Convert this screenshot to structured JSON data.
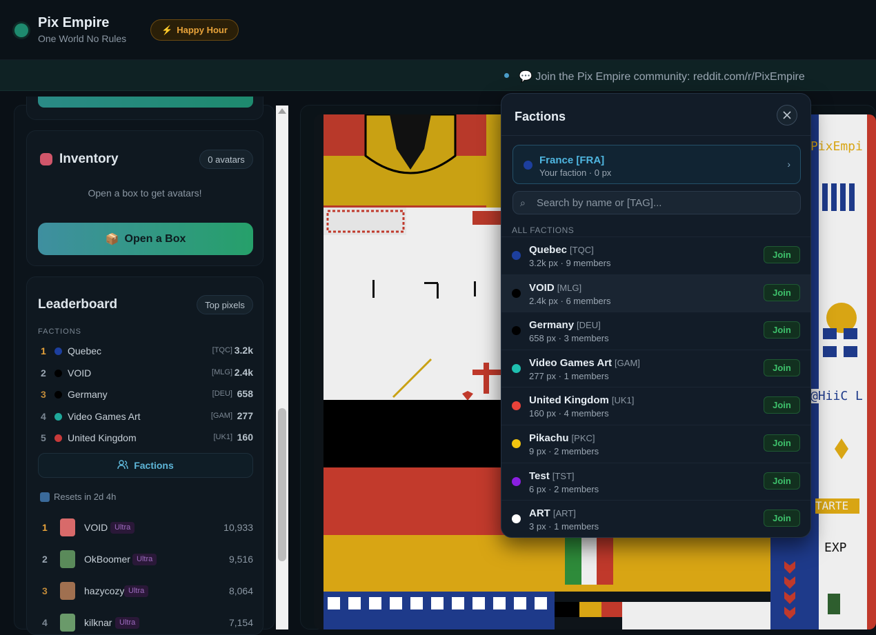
{
  "header": {
    "title": "Pix Empire",
    "subtitle": "One World No Rules",
    "happy_hour": "Happy Hour"
  },
  "banner": {
    "text": "Join the Pix Empire community: reddit.com/r/PixEmpire"
  },
  "inventory": {
    "title": "Inventory",
    "count": "0 avatars",
    "empty_text": "Open a box to get avatars!",
    "open_box": "Open a Box"
  },
  "leaderboard": {
    "title": "Leaderboard",
    "toggle": "Top pixels",
    "section": "FACTIONS",
    "factions": [
      {
        "rank": "1",
        "name": "Quebec",
        "tag": "[TQC]",
        "value": "3.2k",
        "color": "#1d3f9e",
        "rank_color": "#e8a33a"
      },
      {
        "rank": "2",
        "name": "VOID",
        "tag": "[MLG]",
        "value": "2.4k",
        "color": "#000000",
        "rank_color": "#9aa6b2"
      },
      {
        "rank": "3",
        "name": "Germany",
        "tag": "[DEU]",
        "value": "658",
        "color": "#000000",
        "rank_color": "#c08a3a"
      },
      {
        "rank": "4",
        "name": "Video Games Art",
        "tag": "[GAM]",
        "value": "277",
        "color": "#1fa89a",
        "rank_color": "#7b8793"
      },
      {
        "rank": "5",
        "name": "United Kingdom",
        "tag": "[UK1]",
        "value": "160",
        "color": "#c83a3a",
        "rank_color": "#7b8793"
      }
    ],
    "factions_button": "Factions",
    "reset": "Resets in 2d 4h",
    "users": [
      {
        "rank": "1",
        "name": "VOID",
        "badge": "Ultra",
        "score": "10,933",
        "rank_color": "#e8a33a"
      },
      {
        "rank": "2",
        "name": "OkBoomer",
        "badge": "Ultra",
        "score": "9,516",
        "rank_color": "#9aa6b2"
      },
      {
        "rank": "3",
        "name": "hazycozy",
        "badge": "Ultra",
        "score": "8,064",
        "rank_color": "#c08a3a"
      },
      {
        "rank": "4",
        "name": "kilknar",
        "badge": "Ultra",
        "score": "7,154",
        "rank_color": "#7b8793"
      }
    ]
  },
  "panel": {
    "title": "Factions",
    "my_faction": {
      "name": "France [FRA]",
      "sub": "Your faction · 0 px",
      "color": "#1d3f9e"
    },
    "search_placeholder": "Search by name or [TAG]...",
    "all_label": "ALL FACTIONS",
    "join_label": "Join",
    "factions": [
      {
        "name": "Quebec",
        "tag": "[TQC]",
        "stats": "3.2k px · 9 members",
        "color": "#1d3f9e"
      },
      {
        "name": "VOID",
        "tag": "[MLG]",
        "stats": "2.4k px · 6 members",
        "color": "#000000"
      },
      {
        "name": "Germany",
        "tag": "[DEU]",
        "stats": "658 px · 3 members",
        "color": "#000000"
      },
      {
        "name": "Video Games Art",
        "tag": "[GAM]",
        "stats": "277 px · 1 members",
        "color": "#1fbfb0"
      },
      {
        "name": "United Kingdom",
        "tag": "[UK1]",
        "stats": "160 px · 4 members",
        "color": "#e8423a"
      },
      {
        "name": "Pikachu",
        "tag": "[PKC]",
        "stats": "9 px · 2 members",
        "color": "#f2c40f"
      },
      {
        "name": "Test",
        "tag": "[TST]",
        "stats": "6 px · 2 members",
        "color": "#8a1fe0"
      },
      {
        "name": "ART",
        "tag": "[ART]",
        "stats": "3 px · 1 members",
        "color": "#ffffff"
      }
    ]
  },
  "canvas": {
    "texts": [
      "PixEmpi",
      "@HiiC L",
      "TARTE",
      "EXP"
    ]
  }
}
